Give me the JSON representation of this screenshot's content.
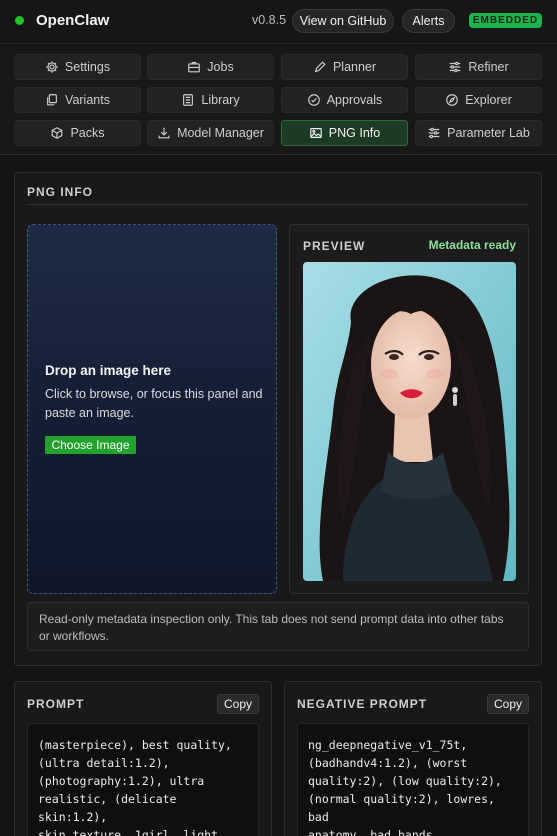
{
  "header": {
    "app_name": "OpenClaw",
    "version": "v0.8.5",
    "github_label": "View on GitHub",
    "alerts_label": "Alerts",
    "mode_badge": "EMBEDDED",
    "status_color": "#21c42b"
  },
  "nav": {
    "items": [
      {
        "label": "Settings",
        "icon": "gear-icon"
      },
      {
        "label": "Jobs",
        "icon": "briefcase-icon"
      },
      {
        "label": "Planner",
        "icon": "pencil-icon"
      },
      {
        "label": "Refiner",
        "icon": "sliders-icon"
      },
      {
        "label": "Variants",
        "icon": "copy-icon"
      },
      {
        "label": "Library",
        "icon": "book-icon"
      },
      {
        "label": "Approvals",
        "icon": "check-circle-icon"
      },
      {
        "label": "Explorer",
        "icon": "compass-icon"
      },
      {
        "label": "Packs",
        "icon": "cube-icon"
      },
      {
        "label": "Model Manager",
        "icon": "download-icon"
      },
      {
        "label": "PNG Info",
        "icon": "image-icon"
      },
      {
        "label": "Parameter Lab",
        "icon": "sliders-icon"
      }
    ],
    "active": "PNG Info"
  },
  "png_info": {
    "title": "PNG INFO",
    "dropzone": {
      "title": "Drop an image here",
      "text": "Click to browse, or focus this panel and paste an image.",
      "button": "Choose Image"
    },
    "preview": {
      "title": "PREVIEW",
      "status": "Metadata ready"
    },
    "note": "Read-only metadata inspection only. This tab does not send prompt data into other tabs or workflows."
  },
  "prompt": {
    "title": "PROMPT",
    "copy_label": "Copy",
    "text": "(masterpiece), best quality,\n(ultra detail:1.2),\n(photography:1.2), ultra\nrealistic, (delicate skin:1.2),\nskin texture, 1girl, light blue\nbackground, (black Long curly"
  },
  "negative_prompt": {
    "title": "NEGATIVE PROMPT",
    "copy_label": "Copy",
    "text": "ng_deepnegative_v1_75t,\n(badhandv4:1.2), (worst\nquality:2), (low quality:2),\n(normal quality:2), lowres, bad\nanatomy, bad hands,\n(monochrome), (grayscale)"
  },
  "colors": {
    "accent_green": "#22a22a",
    "active_tab_bg": "#1d3a22",
    "metadata_ready": "#8de09a"
  }
}
